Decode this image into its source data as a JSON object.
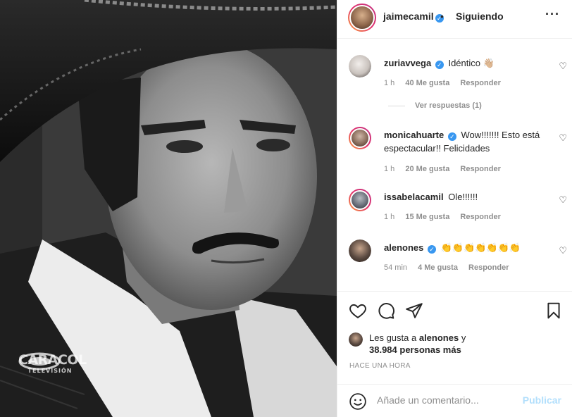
{
  "post": {
    "author": "jaimecamil",
    "follow_status": "Siguiendo",
    "separator": "•",
    "more": "···",
    "watermark": {
      "name": "CARACOL",
      "sub": "TELEVISIÓN"
    }
  },
  "comments": [
    {
      "user": "zuriavvega",
      "verified": true,
      "text": "Idéntico 👋🏼",
      "time": "1 h",
      "likes": "40 Me gusta",
      "reply": "Responder",
      "avatar_color": "#d8d2cf"
    },
    {
      "user": "monicahuarte",
      "verified": true,
      "text": "Wow!!!!!!! Esto está espectacular!! Felicidades",
      "time": "1 h",
      "likes": "20 Me gusta",
      "reply": "Responder",
      "avatar_color": "#8a6d5c"
    },
    {
      "user": "issabelacamil",
      "verified": false,
      "text": "Ole!!!!!!",
      "time": "1 h",
      "likes": "15 Me gusta",
      "reply": "Responder",
      "avatar_color": "#6a6f7a"
    },
    {
      "user": "alenones",
      "verified": true,
      "text": "👏👏👏👏👏👏👏",
      "time": "54 min",
      "likes": "4 Me gusta",
      "reply": "Responder",
      "avatar_color": "#5b4a41"
    }
  ],
  "view_replies": "Ver respuestas (1)",
  "likes": {
    "prefix": "Les gusta a",
    "user": "alenones",
    "joiner": "y",
    "count": "38.984 personas más"
  },
  "time_ago": "HACE UNA HORA",
  "add_comment": {
    "placeholder": "Añade un comentario...",
    "publish": "Publicar"
  },
  "icons": {
    "like": "heart-icon",
    "comment": "comment-icon",
    "share": "share-icon",
    "save": "bookmark-icon",
    "emoji": "emoji-icon",
    "verified": "verified-badge-icon"
  },
  "colors": {
    "verified": "#3897f0",
    "publish_disabled": "#b2dffc",
    "muted": "#8e8e8e",
    "text": "#262626"
  }
}
